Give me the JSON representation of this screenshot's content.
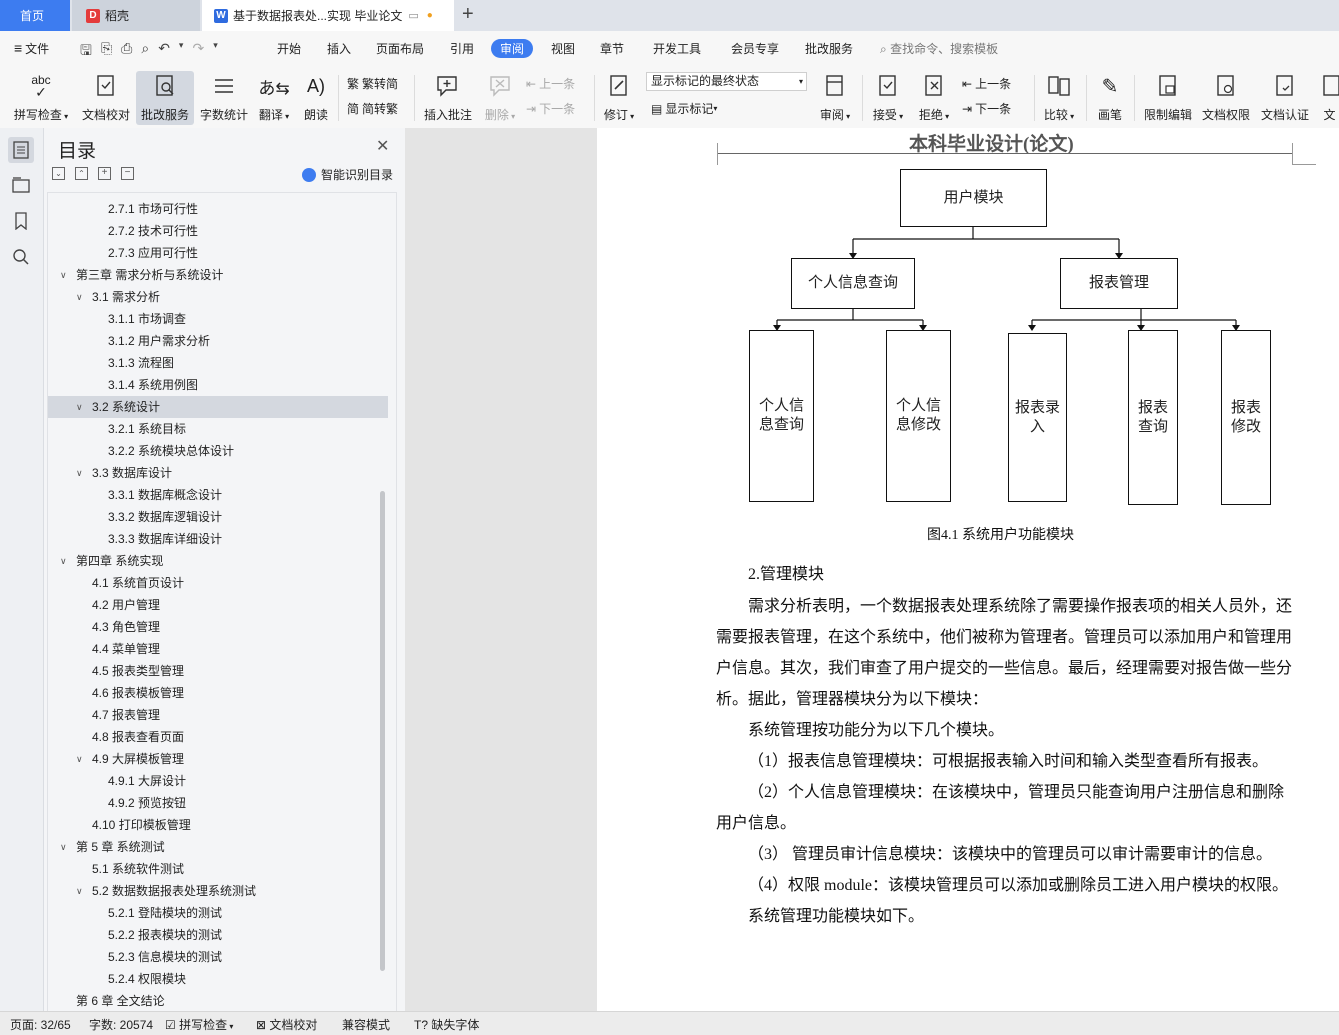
{
  "tabs": {
    "home": "首页",
    "doc1": "稻壳",
    "doc2": "基于数据报表处...实现 毕业论文",
    "new_tab": "+"
  },
  "menu": {
    "file": "文件",
    "items": [
      "开始",
      "插入",
      "页面布局",
      "引用",
      "审阅",
      "视图",
      "章节",
      "开发工具",
      "会员专享",
      "批改服务"
    ],
    "active": "审阅",
    "search": "查找命令、搜索模板"
  },
  "ribbon": {
    "spell": "拼写检查",
    "proof": "文档校对",
    "revise_service": "批改服务",
    "word_count": "字数统计",
    "translate": "翻译",
    "read": "朗读",
    "to_trad": "繁转简",
    "to_simp": "简转繁",
    "insert_comment": "插入批注",
    "delete": "删除",
    "prev": "上一条",
    "next": "下一条",
    "track": "修订",
    "display_state": "显示标记的最终状态",
    "show_markup": "显示标记",
    "review": "审阅",
    "accept": "接受",
    "reject": "拒绝",
    "prev2": "上一条",
    "next2": "下一条",
    "compare": "比较",
    "pen": "画笔",
    "restrict": "限制编辑",
    "doc_rights": "文档权限",
    "doc_cert": "文档认证",
    "cut": "文"
  },
  "toc": {
    "title": "目录",
    "smart": "智能识别目录",
    "items": [
      {
        "label": "2.7.1  市场可行性",
        "level": 3
      },
      {
        "label": "2.7.2  技术可行性",
        "level": 3
      },
      {
        "label": "2.7.3  应用可行性",
        "level": 3
      },
      {
        "label": "第三章  需求分析与系统设计",
        "level": 1
      },
      {
        "label": "3.1  需求分析",
        "level": 2
      },
      {
        "label": "3.1.1 市场调查",
        "level": 3
      },
      {
        "label": "3.1.2  用户需求分析",
        "level": 3
      },
      {
        "label": "3.1.3  流程图",
        "level": 3
      },
      {
        "label": "3.1.4  系统用例图",
        "level": 3
      },
      {
        "label": "3.2  系统设计",
        "level": 2
      },
      {
        "label": "3.2.1  系统目标",
        "level": 3
      },
      {
        "label": "3.2.2  系统模块总体设计",
        "level": 3
      },
      {
        "label": "3.3  数据库设计",
        "level": 2
      },
      {
        "label": "3.3.1  数据库概念设计",
        "level": 3
      },
      {
        "label": "3.3.2  数据库逻辑设计",
        "level": 3
      },
      {
        "label": "3.3.3 数据库详细设计",
        "level": 3
      },
      {
        "label": "第四章  系统实现",
        "level": 1
      },
      {
        "label": "4.1  系统首页设计",
        "level": 2
      },
      {
        "label": "4.2  用户管理",
        "level": 2
      },
      {
        "label": "4.3  角色管理",
        "level": 2
      },
      {
        "label": "4.4  菜单管理",
        "level": 2
      },
      {
        "label": "4.5  报表类型管理",
        "level": 2
      },
      {
        "label": "4.6  报表模板管理",
        "level": 2
      },
      {
        "label": "4.7  报表管理",
        "level": 2
      },
      {
        "label": "4.8  报表查看页面",
        "level": 2
      },
      {
        "label": "4.9  大屏模板管理",
        "level": 2
      },
      {
        "label": "4.9.1  大屏设计",
        "level": 3
      },
      {
        "label": "4.9.2  预览按钮",
        "level": 3
      },
      {
        "label": "4.10  打印模板管理",
        "level": 2
      },
      {
        "label": "第 5 章  系统测试",
        "level": 1
      },
      {
        "label": "5.1  系统软件测试",
        "level": 2
      },
      {
        "label": "5.2    数据数据报表处理系统测试",
        "level": 2
      },
      {
        "label": "5.2.1  登陆模块的测试",
        "level": 3
      },
      {
        "label": "5.2.2  报表模块的测试",
        "level": 3
      },
      {
        "label": "5.2.3 信息模块的测试",
        "level": 3
      },
      {
        "label": "5.2.4 权限模块",
        "level": 3
      },
      {
        "label": "第 6 章  全文结论",
        "level": 1
      }
    ]
  },
  "doc": {
    "header": "本科毕业设计(论文)",
    "diagram": {
      "root": "用户模块",
      "mid_left": "个人信息查询",
      "mid_right": "报表管理",
      "leaf1": "个人信息查询",
      "leaf2": "个人信息修改",
      "leaf3": "报表录入",
      "leaf4": "报表查询",
      "leaf5": "报表修改"
    },
    "caption": "图4.1  系统用户功能模块",
    "heading": "2.管理模块",
    "lines": [
      "需求分析表明，一个数据报表处理系统除了需要操作报表项的相关人员外，还",
      "需要报表管理，在这个系统中，他们被称为管理者。管理员可以添加用户和管理用",
      "户信息。其次，我们审查了用户提交的一些信息。最后，经理需要对报告做一些分",
      "析。据此，管理器模块分为以下模块：",
      "系统管理按功能分为以下几个模块。",
      "（1）报表信息管理模块：可根据报表输入时间和输入类型查看所有报表。",
      "（2）个人信息管理模块：在该模块中，管理员只能查询用户注册信息和删除",
      "用户信息。",
      "（3）  管理员审计信息模块：该模块中的管理员可以审计需要审计的信息。",
      "（4）权限 module：该模块管理员可以添加或删除员工进入用户模块的权限。",
      "系统管理功能模块如下。"
    ]
  },
  "status": {
    "page": "页面: 32/65",
    "words": "字数: 20574",
    "spell": "拼写检查",
    "proof": "文档校对",
    "compat": "兼容模式",
    "missing_font": "缺失字体"
  }
}
